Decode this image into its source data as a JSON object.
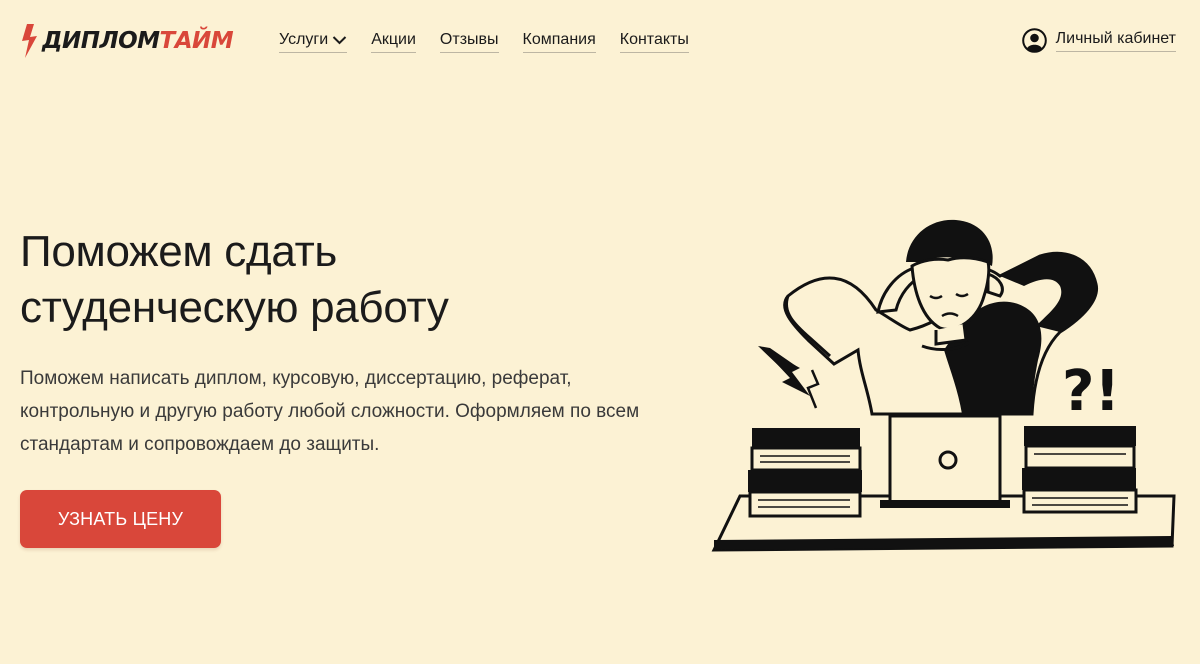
{
  "brand": {
    "logo_part1": "ДИПЛОМ",
    "logo_part2": "ТАЙМ",
    "accent_color": "#d9473a",
    "background_color": "#fcf2d4"
  },
  "nav": {
    "items": [
      {
        "label": "Услуги",
        "icon": "chevron-down-icon"
      },
      {
        "label": "Акции"
      },
      {
        "label": "Отзывы"
      },
      {
        "label": "Компания"
      },
      {
        "label": "Контакты"
      }
    ]
  },
  "account": {
    "label": "Личный кабинет",
    "icon": "user-icon"
  },
  "hero": {
    "title_line1": "Поможем сдать",
    "title_line2": "студенческую работу",
    "description": "Поможем написать диплом, курсовую, диссертацию, реферат, контрольную и другую работу любой сложности. Оформляем по всем стандартам и сопровождаем до защиты.",
    "cta_label": "УЗНАТЬ ЦЕНУ"
  },
  "illustration": {
    "question_glyphs": "?!"
  }
}
